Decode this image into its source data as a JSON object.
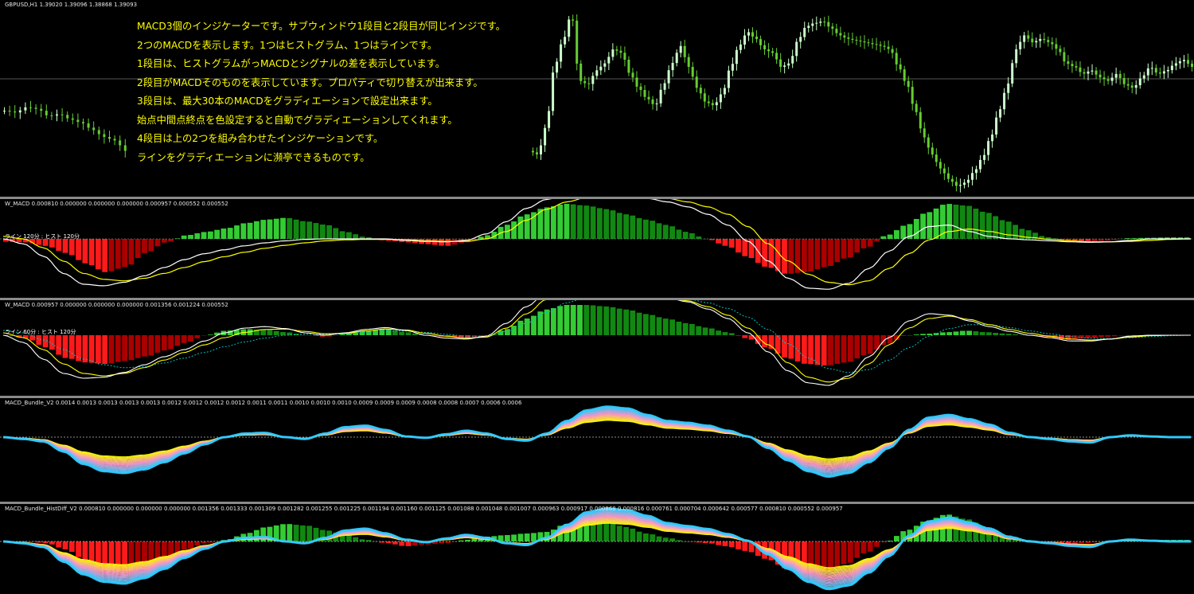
{
  "window": {
    "symbol_title": "GBPUSD,H1  1.39020 1.39096 1.38868 1.39093"
  },
  "annotation": {
    "lines": [
      "MACD3個のインジケーターです。サブウィンドウ1段目と2段目が同じインジです。",
      "2つのMACDを表示します。1つはヒストグラム、1つはラインです。",
      "1段目は、ヒストグラムがっMACDとシグナルの差を表示しています。",
      "2段目がMACDそのものを表示しています。プロパティで切り替えが出来ます。",
      "3段目は、最大30本のMACDをグラディエーションで設定出来ます。",
      "始点中間点終点を色設定すると自動でグラディエーションしてくれます。",
      "4段目は上の2つを組み合わせたインジケーションです。",
      "ラインをグラディエーションに瀕亭できるものです。"
    ],
    "color": "#ffff00"
  },
  "subwindows": [
    {
      "title": "W_MACD 0.000810 0.000000 0.000000 0.000000 0.000957 0.000552 0.000552",
      "tf_label": "ライン  120分 : ヒスト  120分"
    },
    {
      "title": "W_MACD 0.000957 0.000000 0.000000 0.000000 0.001356 0.001224 0.000552",
      "tf_label": "ライン  60分 : ヒスト  120分"
    },
    {
      "title": "MACD_Bundle_V2 0.0014 0.0013 0.0013 0.0013 0.0013 0.0012 0.0012 0.0012 0.0012 0.0011 0.0011 0.0010 0.0010 0.0010 0.0009 0.0009 0.0009 0.0008 0.0008 0.0007 0.0006 0.0006"
    },
    {
      "title": "MACD_Bundle_HistDiff_V2 0.000810 0.000000 0.000000 0.000000 0.001356 0.001333 0.001309 0.001282 0.001255 0.001225 0.001194 0.001160 0.001125 0.001088 0.001048 0.001007 0.000963 0.000917 0.000868 0.000816 0.000761 0.000704 0.000642 0.000577 0.000810 0.000552 0.000957"
    }
  ],
  "colors": {
    "background": "#000000",
    "bull_candle": "#ccffcc",
    "bear_candle": "#66cc33",
    "hist_positive": [
      "#33cc33",
      "#118811"
    ],
    "hist_negative": [
      "#ff1a1a",
      "#aa0000"
    ],
    "macd_line": "#ffffff",
    "signal_line": "#ffff00",
    "dotted_signal": "#00bfbf",
    "gradient": [
      "#ffff00",
      "#ff99cc",
      "#33ccff"
    ],
    "separator": "#8a8a8a"
  },
  "chart_data": [
    {
      "type": "candlestick",
      "symbol": "GBPUSD",
      "timeframe": "H1",
      "ohlc_header": {
        "open": 1.3902,
        "high": 1.39096,
        "low": 1.38868,
        "close": 1.39093
      },
      "shape": [
        0.45,
        0.44,
        0.47,
        0.46,
        0.42,
        0.43,
        0.4,
        0.38,
        0.34,
        0.3,
        0.28,
        0.22,
        0.2,
        0.36,
        0.7,
        0.85,
        1.0,
        0.62,
        0.6,
        0.68,
        0.72,
        0.8,
        0.78,
        0.66,
        0.58,
        0.52,
        0.48,
        0.6,
        0.72,
        0.82,
        0.7,
        0.58,
        0.5,
        0.48,
        0.55,
        0.7,
        0.82,
        0.9,
        0.86,
        0.8,
        0.78,
        0.7,
        0.72,
        0.85,
        0.93,
        0.95,
        0.96,
        0.92,
        0.88,
        0.86,
        0.85,
        0.84,
        0.83,
        0.82,
        0.8,
        0.7,
        0.6,
        0.45,
        0.3,
        0.2,
        0.12,
        0.06,
        0.02,
        0.04,
        0.1,
        0.18,
        0.3,
        0.45,
        0.6,
        0.8,
        0.88,
        0.84,
        0.86,
        0.84,
        0.8,
        0.72,
        0.7,
        0.66,
        0.68,
        0.64,
        0.62,
        0.66,
        0.6,
        0.58,
        0.64,
        0.7,
        0.66,
        0.68,
        0.72,
        0.74,
        0.7
      ]
    },
    {
      "type": "bar",
      "name": "W_MACD (1)",
      "histogram": [
        -0.08,
        -0.1,
        -0.2,
        -0.4,
        -0.7,
        -0.95,
        -0.8,
        -0.4,
        -0.1,
        0.1,
        0.2,
        0.3,
        0.45,
        0.55,
        0.6,
        0.5,
        0.4,
        0.2,
        0.05,
        -0.05,
        -0.1,
        -0.15,
        -0.2,
        -0.1,
        0.1,
        0.4,
        0.7,
        0.9,
        1.0,
        0.95,
        0.85,
        0.7,
        0.55,
        0.4,
        0.2,
        0.0,
        -0.2,
        -0.5,
        -0.8,
        -1.0,
        -0.95,
        -0.8,
        -0.55,
        -0.25,
        0.1,
        0.4,
        0.75,
        1.0,
        0.95,
        0.75,
        0.5,
        0.25,
        0.05,
        -0.05,
        -0.1,
        -0.05,
        0.02,
        0.03,
        0.04,
        0.04
      ],
      "macd": [
        0.0,
        -0.1,
        -0.35,
        -0.7,
        -0.92,
        -0.95,
        -0.88,
        -0.75,
        -0.58,
        -0.42,
        -0.3,
        -0.22,
        -0.14,
        -0.08,
        -0.04,
        -0.01,
        0.0,
        0.0,
        0.0,
        0.0,
        -0.03,
        -0.05,
        -0.06,
        -0.03,
        0.1,
        0.35,
        0.62,
        0.8,
        0.9,
        0.93,
        0.9,
        0.86,
        0.82,
        0.75,
        0.65,
        0.5,
        0.28,
        -0.05,
        -0.45,
        -0.8,
        -1.0,
        -1.02,
        -0.9,
        -0.6,
        -0.25,
        0.05,
        0.25,
        0.28,
        0.15,
        0.05,
        0.0,
        -0.02,
        -0.04,
        -0.06,
        -0.07,
        -0.06,
        -0.03,
        0.0,
        0.0,
        0.0
      ],
      "signal": [
        0.05,
        0.0,
        -0.18,
        -0.45,
        -0.7,
        -0.82,
        -0.85,
        -0.8,
        -0.7,
        -0.58,
        -0.46,
        -0.36,
        -0.27,
        -0.19,
        -0.13,
        -0.08,
        -0.04,
        -0.02,
        -0.01,
        -0.01,
        -0.02,
        -0.04,
        -0.05,
        -0.05,
        0.0,
        0.15,
        0.38,
        0.6,
        0.75,
        0.84,
        0.88,
        0.88,
        0.86,
        0.82,
        0.75,
        0.65,
        0.5,
        0.25,
        -0.1,
        -0.45,
        -0.72,
        -0.88,
        -0.93,
        -0.85,
        -0.6,
        -0.3,
        -0.02,
        0.15,
        0.2,
        0.15,
        0.08,
        0.03,
        -0.01,
        -0.04,
        -0.06,
        -0.06,
        -0.05,
        -0.03,
        -0.01,
        0.0
      ]
    },
    {
      "type": "bar",
      "name": "W_MACD (2)",
      "histogram": [
        0.0,
        -0.1,
        -0.4,
        -0.75,
        -0.9,
        -0.95,
        -0.85,
        -0.7,
        -0.5,
        -0.25,
        0.0,
        0.15,
        0.2,
        0.18,
        0.1,
        0.0,
        -0.05,
        0.05,
        0.15,
        0.2,
        0.1,
        0.0,
        -0.05,
        -0.1,
        -0.05,
        0.2,
        0.55,
        0.85,
        1.0,
        1.0,
        0.95,
        0.85,
        0.7,
        0.55,
        0.4,
        0.25,
        0.1,
        -0.1,
        -0.4,
        -0.75,
        -0.95,
        -1.0,
        -0.9,
        -0.65,
        -0.3,
        0.0,
        0.05,
        0.1,
        0.15,
        0.1,
        0.05,
        0.0,
        -0.05,
        -0.15,
        -0.1,
        -0.05,
        0.0,
        0.0,
        0.0,
        0.0
      ],
      "macd": [
        0.0,
        -0.15,
        -0.5,
        -0.8,
        -0.9,
        -0.88,
        -0.78,
        -0.62,
        -0.45,
        -0.3,
        -0.12,
        0.05,
        0.15,
        0.18,
        0.14,
        0.05,
        0.0,
        0.05,
        0.12,
        0.16,
        0.1,
        0.0,
        -0.06,
        -0.08,
        -0.02,
        0.25,
        0.6,
        0.9,
        1.0,
        0.98,
        0.94,
        0.9,
        0.85,
        0.78,
        0.7,
        0.55,
        0.35,
        0.05,
        -0.35,
        -0.75,
        -1.0,
        -1.05,
        -0.85,
        -0.45,
        -0.05,
        0.3,
        0.45,
        0.42,
        0.3,
        0.18,
        0.08,
        0.0,
        -0.05,
        -0.12,
        -0.12,
        -0.08,
        -0.02,
        0.0,
        0.0,
        0.0
      ],
      "signal": [
        0.05,
        -0.05,
        -0.3,
        -0.6,
        -0.8,
        -0.85,
        -0.8,
        -0.68,
        -0.52,
        -0.36,
        -0.2,
        -0.05,
        0.06,
        0.12,
        0.13,
        0.08,
        0.03,
        0.04,
        0.09,
        0.13,
        0.11,
        0.04,
        -0.02,
        -0.06,
        -0.04,
        0.15,
        0.45,
        0.75,
        0.92,
        0.96,
        0.94,
        0.9,
        0.86,
        0.8,
        0.72,
        0.6,
        0.42,
        0.15,
        -0.2,
        -0.58,
        -0.88,
        -0.98,
        -0.9,
        -0.6,
        -0.2,
        0.15,
        0.35,
        0.4,
        0.33,
        0.22,
        0.12,
        0.04,
        -0.02,
        -0.08,
        -0.1,
        -0.08,
        -0.04,
        -0.01,
        0.0,
        0.0
      ],
      "dotted": [
        0.1,
        0.05,
        -0.1,
        -0.3,
        -0.5,
        -0.62,
        -0.68,
        -0.66,
        -0.58,
        -0.48,
        -0.36,
        -0.24,
        -0.14,
        -0.06,
        0.0,
        0.02,
        0.02,
        0.03,
        0.06,
        0.09,
        0.09,
        0.06,
        0.02,
        -0.02,
        -0.02,
        0.08,
        0.25,
        0.48,
        0.68,
        0.8,
        0.86,
        0.88,
        0.86,
        0.82,
        0.76,
        0.68,
        0.56,
        0.38,
        0.12,
        -0.18,
        -0.48,
        -0.7,
        -0.78,
        -0.72,
        -0.52,
        -0.26,
        -0.02,
        0.14,
        0.22,
        0.22,
        0.16,
        0.09,
        0.03,
        -0.03,
        -0.06,
        -0.07,
        -0.05,
        -0.03,
        -0.01,
        0.0
      ]
    },
    {
      "type": "line",
      "name": "MACD_Bundle_V2",
      "base": [
        0.0,
        -0.05,
        -0.12,
        -0.4,
        -0.75,
        -0.95,
        -1.0,
        -0.9,
        -0.7,
        -0.45,
        -0.2,
        0.0,
        0.1,
        0.12,
        0.0,
        -0.05,
        0.1,
        0.28,
        0.32,
        0.2,
        0.02,
        -0.02,
        0.08,
        0.18,
        0.1,
        -0.05,
        -0.1,
        0.1,
        0.45,
        0.75,
        0.85,
        0.8,
        0.62,
        0.45,
        0.4,
        0.32,
        0.18,
        0.02,
        -0.3,
        -0.65,
        -0.95,
        -1.1,
        -1.0,
        -0.7,
        -0.3,
        0.2,
        0.55,
        0.62,
        0.5,
        0.35,
        0.12,
        0.0,
        -0.05,
        -0.12,
        -0.15,
        0.0,
        0.05,
        0.02,
        0.0,
        0.0
      ]
    },
    {
      "type": "line",
      "name": "MACD_Bundle_HistDiff_V2",
      "base": [
        0.0,
        -0.05,
        -0.15,
        -0.55,
        -0.9,
        -1.1,
        -1.15,
        -1.0,
        -0.75,
        -0.45,
        -0.2,
        0.0,
        0.1,
        0.12,
        0.0,
        -0.05,
        0.1,
        0.3,
        0.35,
        0.22,
        0.05,
        -0.02,
        0.08,
        0.18,
        0.1,
        -0.05,
        -0.1,
        0.1,
        0.45,
        0.8,
        0.9,
        0.85,
        0.7,
        0.5,
        0.42,
        0.34,
        0.2,
        0.02,
        -0.35,
        -0.75,
        -1.1,
        -1.3,
        -1.2,
        -0.85,
        -0.4,
        0.15,
        0.55,
        0.65,
        0.52,
        0.35,
        0.12,
        0.0,
        -0.05,
        -0.12,
        -0.15,
        0.0,
        0.05,
        0.02,
        0.0,
        0.0
      ],
      "histogram": [
        0.0,
        0.0,
        -0.05,
        -0.25,
        -0.6,
        -0.9,
        -0.95,
        -0.8,
        -0.5,
        -0.25,
        -0.05,
        0.05,
        0.25,
        0.45,
        0.55,
        0.5,
        0.35,
        0.2,
        0.05,
        -0.05,
        -0.15,
        -0.1,
        -0.05,
        0.05,
        0.15,
        0.2,
        0.25,
        0.3,
        0.55,
        0.7,
        0.6,
        0.45,
        0.25,
        0.12,
        0.0,
        -0.05,
        -0.15,
        -0.3,
        -0.55,
        -0.85,
        -1.0,
        -0.95,
        -0.7,
        -0.35,
        0.0,
        0.35,
        0.65,
        0.85,
        0.7,
        0.45,
        0.2,
        0.05,
        -0.05,
        -0.1,
        -0.05,
        0.02,
        0.05,
        0.05,
        0.05,
        0.05
      ]
    }
  ]
}
